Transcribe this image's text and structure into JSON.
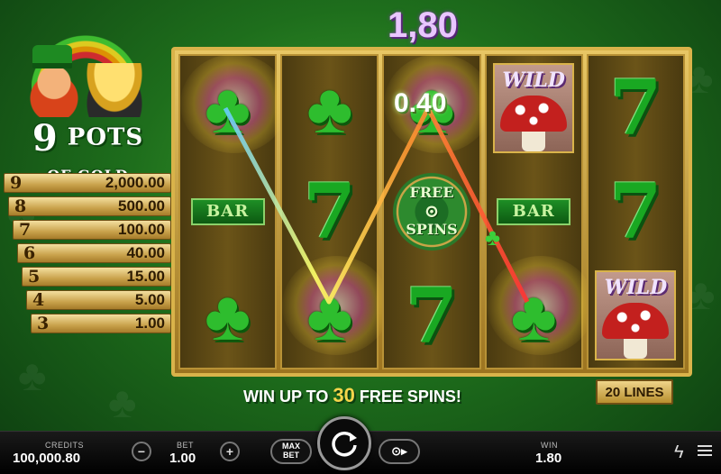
{
  "logo": {
    "line1": "9",
    "line2": "POTS",
    "line3": "OF GOLD"
  },
  "paytable": [
    {
      "pots": "9",
      "amount": "2,000.00"
    },
    {
      "pots": "8",
      "amount": "500.00"
    },
    {
      "pots": "7",
      "amount": "100.00"
    },
    {
      "pots": "6",
      "amount": "40.00"
    },
    {
      "pots": "5",
      "amount": "15.00"
    },
    {
      "pots": "4",
      "amount": "5.00"
    },
    {
      "pots": "3",
      "amount": "1.00"
    }
  ],
  "total_win": "1,80",
  "line_win": "0.40",
  "reels": {
    "bar_label": "BAR",
    "wild_label": "WILD",
    "scatter_line1": "FREE",
    "scatter_line2": "SPINS",
    "seven_glyph": "7"
  },
  "banner": {
    "prefix": "WIN UP TO",
    "number": "30",
    "suffix": "FREE SPINS!"
  },
  "lines_button": "20 LINES",
  "bottom_bar": {
    "credits_label": "CREDITS",
    "credits_value": "100,000.80",
    "bet_label": "BET",
    "bet_value": "1.00",
    "minus": "−",
    "plus": "+",
    "max_bet": "MAX\nBET",
    "win_label": "WIN",
    "win_value": "1.80"
  },
  "icons": [
    "clover-icon",
    "seven-icon",
    "bar-icon",
    "wild-mushroom-icon",
    "free-spins-scatter-icon",
    "spin-icon",
    "autoplay-icon",
    "turbo-lightning-icon",
    "menu-icon"
  ],
  "colors": {
    "frame_gold": "#d9b34a",
    "background_green": "#1e6e1c",
    "win_purple": "#e9c6ff",
    "highlight_yellow": "#f5d44b"
  }
}
